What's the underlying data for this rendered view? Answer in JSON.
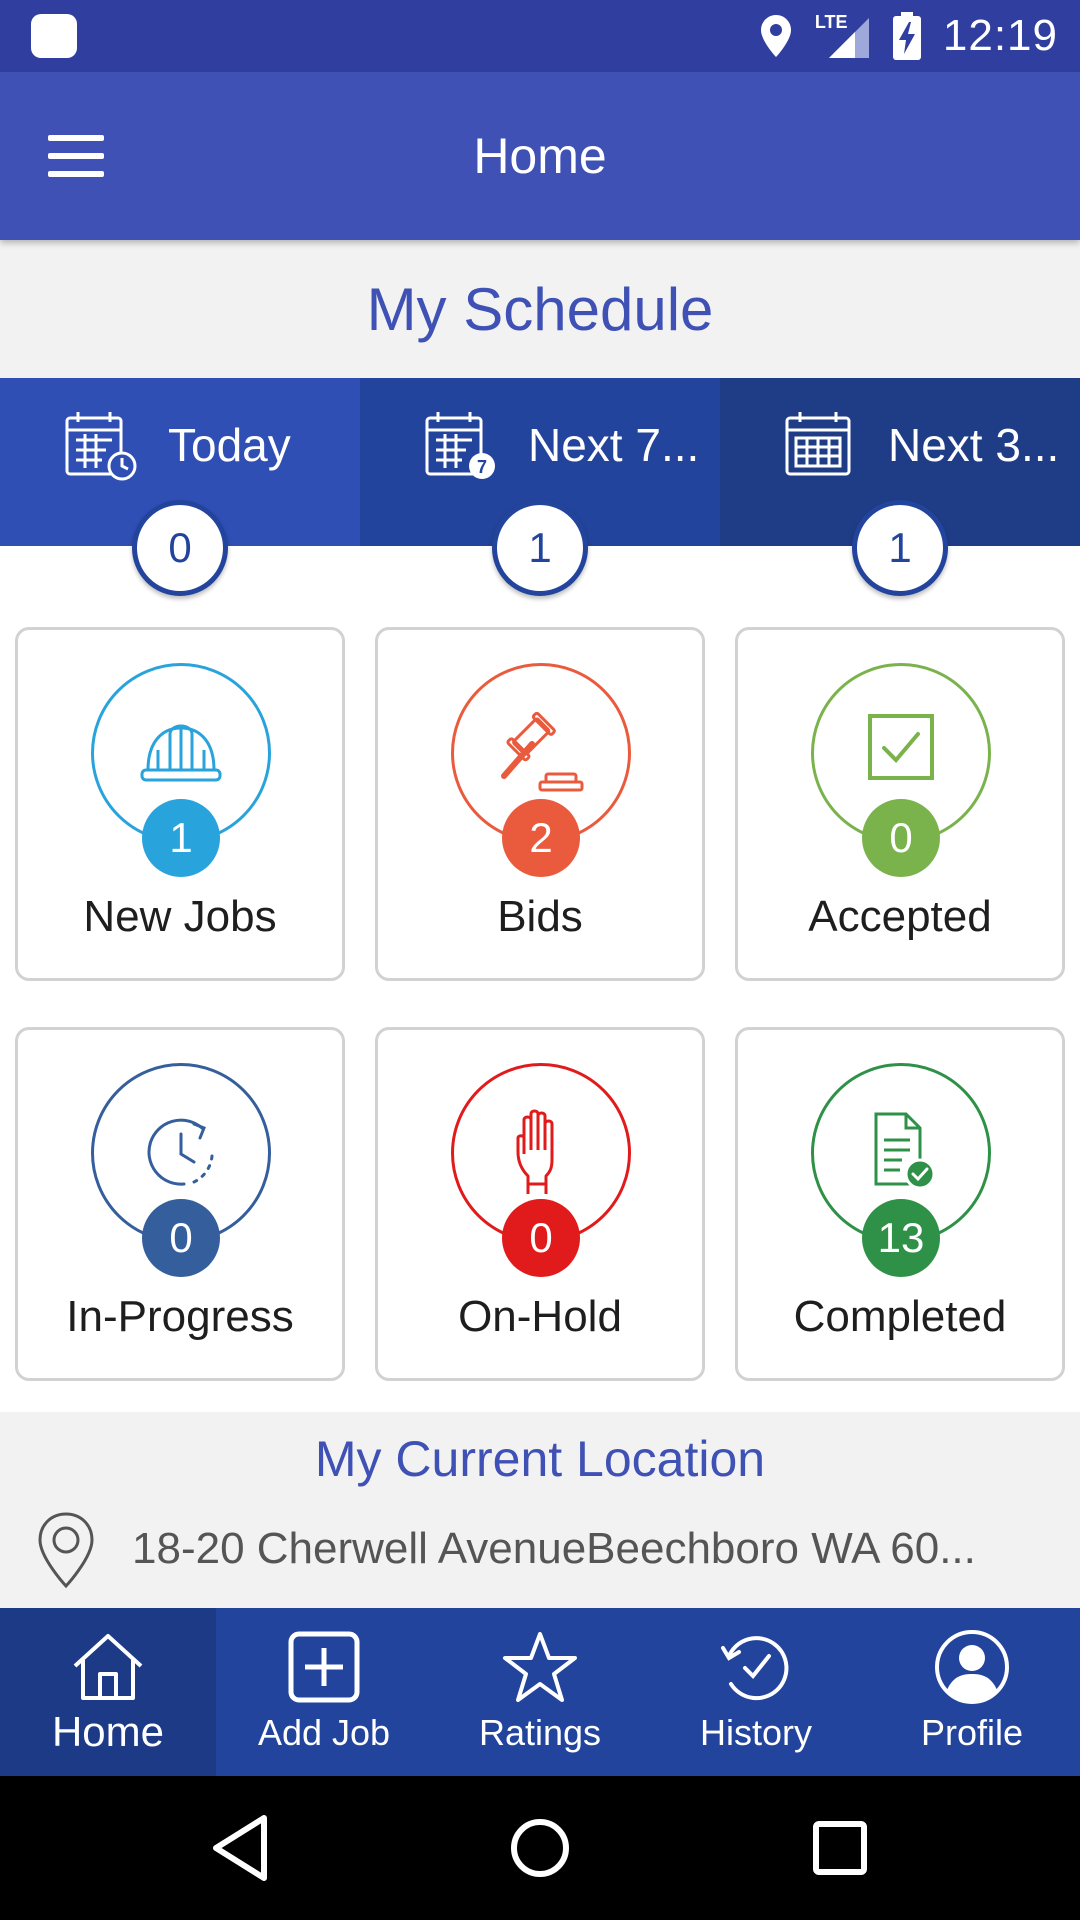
{
  "status_bar": {
    "time": "12:19",
    "network_label": "LTE",
    "icons": [
      "app-icon",
      "location-icon",
      "signal-icon",
      "battery-charging-icon"
    ]
  },
  "app_bar": {
    "title": "Home",
    "menu_icon": "hamburger-menu-icon"
  },
  "schedule": {
    "title": "My Schedule",
    "tabs": [
      {
        "label": "Today",
        "count": "0",
        "icon": "calendar-clock-icon"
      },
      {
        "label": "Next 7...",
        "count": "1",
        "icon": "calendar-7-icon"
      },
      {
        "label": "Next 3...",
        "count": "1",
        "icon": "calendar-icon"
      }
    ]
  },
  "cards": [
    {
      "label": "New Jobs",
      "count": "1",
      "icon": "hard-hat-icon",
      "color": "#29a3db"
    },
    {
      "label": "Bids",
      "count": "2",
      "icon": "gavel-icon",
      "color": "#ea5b3e"
    },
    {
      "label": "Accepted",
      "count": "0",
      "icon": "checkbox-icon",
      "color": "#7ab24c"
    },
    {
      "label": "In-Progress",
      "count": "0",
      "icon": "clock-progress-icon",
      "color": "#345e9c"
    },
    {
      "label": "On-Hold",
      "count": "0",
      "icon": "raised-hand-icon",
      "color": "#e11b1b"
    },
    {
      "label": "Completed",
      "count": "13",
      "icon": "document-check-icon",
      "color": "#2e9147"
    }
  ],
  "location": {
    "title": "My Current Location",
    "address": "18-20 Cherwell AvenueBeechboro WA 60...",
    "icon": "map-pin-icon"
  },
  "bottom_nav": [
    {
      "label": "Home",
      "icon": "home-icon",
      "active": true
    },
    {
      "label": "Add Job",
      "icon": "add-box-icon",
      "active": false
    },
    {
      "label": "Ratings",
      "icon": "star-icon",
      "active": false
    },
    {
      "label": "History",
      "icon": "history-icon",
      "active": false
    },
    {
      "label": "Profile",
      "icon": "profile-icon",
      "active": false
    }
  ],
  "system_nav": [
    "back-icon",
    "home-circle-icon",
    "recents-icon"
  ],
  "colors": {
    "status_bar": "#303f9f",
    "app_bar": "#3f51b5",
    "accent": "#23449d"
  }
}
